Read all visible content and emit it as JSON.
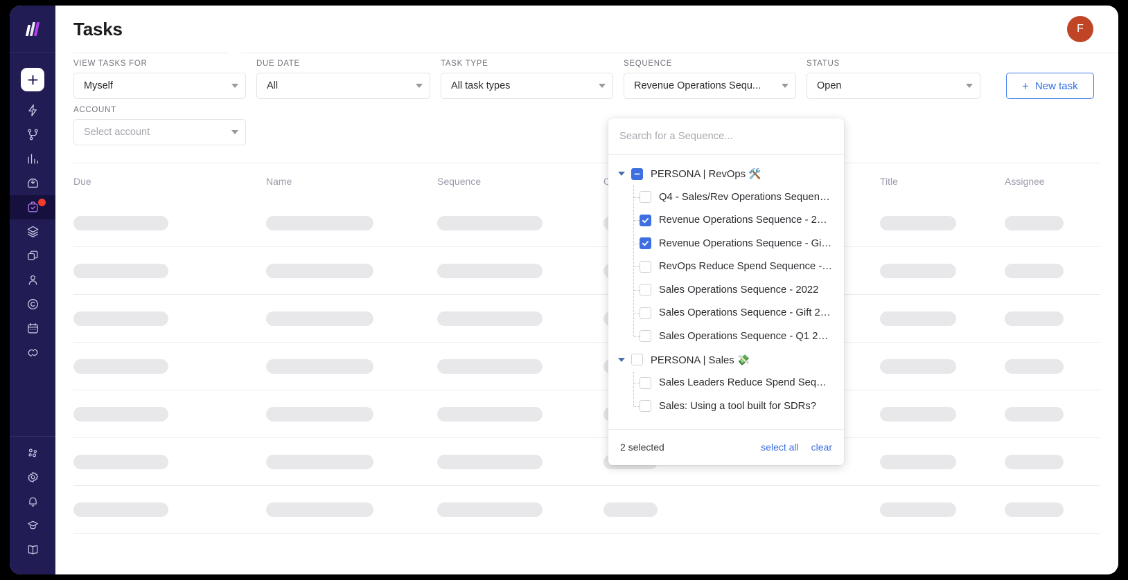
{
  "window": {
    "title": "Tasks"
  },
  "sidebar": {
    "logo": "workspace-logo",
    "add_button": "+",
    "items": [
      {
        "name": "bolt-icon",
        "label": "Bolt",
        "active": false
      },
      {
        "name": "workflow-icon",
        "label": "Workflow",
        "active": false
      },
      {
        "name": "chart-bar-icon",
        "label": "Reports",
        "active": false
      },
      {
        "name": "inbox-icon",
        "label": "Inbox",
        "active": false
      },
      {
        "name": "tasks-icon",
        "label": "Tasks",
        "active": true,
        "badge": true
      },
      {
        "name": "layers-icon",
        "label": "Layers",
        "active": false
      },
      {
        "name": "copy-icon",
        "label": "Templates",
        "active": false
      },
      {
        "name": "person-icon",
        "label": "Contacts",
        "active": false
      },
      {
        "name": "company-icon",
        "label": "Companies",
        "active": false
      },
      {
        "name": "calendar-icon",
        "label": "Calendar",
        "active": false
      },
      {
        "name": "link-icon",
        "label": "Integrations",
        "active": false
      }
    ],
    "bottom_items": [
      {
        "name": "team-icon",
        "label": "Team"
      },
      {
        "name": "gear-icon",
        "label": "Settings"
      },
      {
        "name": "bell-icon",
        "label": "Notifications"
      },
      {
        "name": "academy-icon",
        "label": "Academy"
      },
      {
        "name": "book-icon",
        "label": "Knowledge Base"
      }
    ]
  },
  "header": {
    "title": "Tasks",
    "avatar_initial": "F",
    "avatar_color": "#c04526"
  },
  "filters": {
    "view_tasks_for": {
      "label": "VIEW TASKS FOR",
      "value": "Myself",
      "placeholder": ""
    },
    "due_date": {
      "label": "DUE DATE",
      "value": "All",
      "placeholder": ""
    },
    "task_type": {
      "label": "TASK TYPE",
      "value": "All task types",
      "placeholder": ""
    },
    "sequence": {
      "label": "SEQUENCE",
      "value": "Revenue Operations Sequ...",
      "placeholder": ""
    },
    "status": {
      "label": "STATUS",
      "value": "Open",
      "placeholder": ""
    },
    "account": {
      "label": "ACCOUNT",
      "value": "",
      "placeholder": "Select account"
    },
    "new_task_button": {
      "label": "New task",
      "plus": "+"
    }
  },
  "sequence_dropdown": {
    "search_placeholder": "Search for a Sequence...",
    "search_value": "",
    "groups": [
      {
        "label": "PERSONA | RevOps 🛠️",
        "state": "indeterminate",
        "expanded": true,
        "items": [
          {
            "label": "Q4 - Sales/Rev Operations Sequen…",
            "checked": false
          },
          {
            "label": "Revenue Operations Sequence - 2…",
            "checked": true
          },
          {
            "label": "Revenue Operations Sequence - Gi…",
            "checked": true
          },
          {
            "label": "RevOps Reduce Spend Sequence -…",
            "checked": false
          },
          {
            "label": "Sales Operations Sequence - 2022",
            "checked": false
          },
          {
            "label": "Sales Operations Sequence - Gift 2…",
            "checked": false
          },
          {
            "label": "Sales Operations Sequence - Q1 2…",
            "checked": false
          }
        ]
      },
      {
        "label": "PERSONA | Sales 💸",
        "state": "unchecked",
        "expanded": true,
        "items": [
          {
            "label": "Sales Leaders Reduce Spend Seq…",
            "checked": false
          },
          {
            "label": "Sales: Using a tool built for SDRs?",
            "checked": false
          }
        ]
      }
    ],
    "footer": {
      "count_label": "2 selected",
      "select_all_label": "select all",
      "clear_label": "clear"
    }
  },
  "table": {
    "columns": [
      "Due",
      "Name",
      "Sequence",
      "Open",
      "Title",
      "Assignee"
    ],
    "row_count": 7,
    "loading": true
  },
  "colors": {
    "sidebar_bg": "#221c55",
    "accent_blue": "#3d6fe0",
    "badge_red": "#f03b2e",
    "skeleton": "#e8e8ea"
  }
}
